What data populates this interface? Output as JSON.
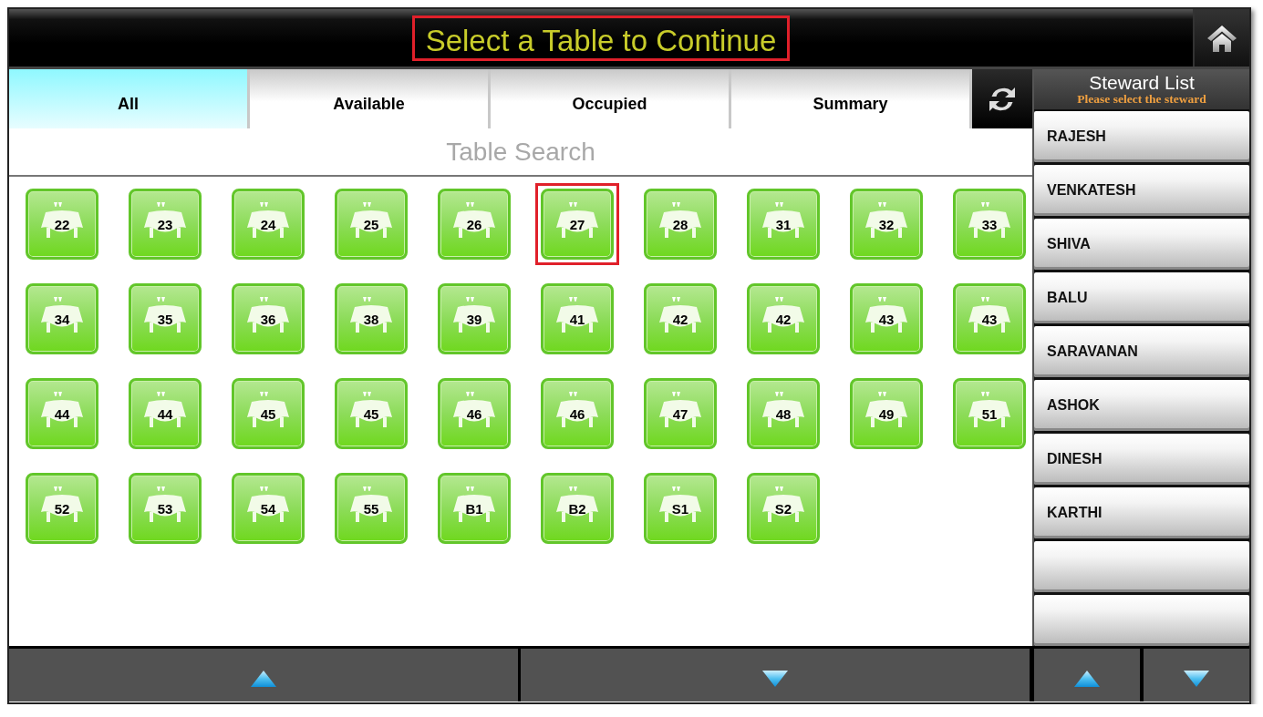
{
  "header": {
    "title": "Select a Table to Continue",
    "highlighted": true
  },
  "tabs": [
    {
      "label": "All",
      "selected": true
    },
    {
      "label": "Available",
      "selected": false
    },
    {
      "label": "Occupied",
      "selected": false
    },
    {
      "label": "Summary",
      "selected": false
    }
  ],
  "search": {
    "placeholder": "Table Search"
  },
  "tables": [
    {
      "number": "22",
      "highlighted": false
    },
    {
      "number": "23",
      "highlighted": false
    },
    {
      "number": "24",
      "highlighted": false
    },
    {
      "number": "25",
      "highlighted": false
    },
    {
      "number": "26",
      "highlighted": false
    },
    {
      "number": "27",
      "highlighted": true
    },
    {
      "number": "28",
      "highlighted": false
    },
    {
      "number": "31",
      "highlighted": false
    },
    {
      "number": "32",
      "highlighted": false
    },
    {
      "number": "33",
      "highlighted": false
    },
    {
      "number": "34",
      "highlighted": false
    },
    {
      "number": "35",
      "highlighted": false
    },
    {
      "number": "36",
      "highlighted": false
    },
    {
      "number": "38",
      "highlighted": false
    },
    {
      "number": "39",
      "highlighted": false
    },
    {
      "number": "41",
      "highlighted": false
    },
    {
      "number": "42",
      "highlighted": false
    },
    {
      "number": "42",
      "highlighted": false
    },
    {
      "number": "43",
      "highlighted": false
    },
    {
      "number": "43",
      "highlighted": false
    },
    {
      "number": "44",
      "highlighted": false
    },
    {
      "number": "44",
      "highlighted": false
    },
    {
      "number": "45",
      "highlighted": false
    },
    {
      "number": "45",
      "highlighted": false
    },
    {
      "number": "46",
      "highlighted": false
    },
    {
      "number": "46",
      "highlighted": false
    },
    {
      "number": "47",
      "highlighted": false
    },
    {
      "number": "48",
      "highlighted": false
    },
    {
      "number": "49",
      "highlighted": false
    },
    {
      "number": "51",
      "highlighted": false
    },
    {
      "number": "52",
      "highlighted": false
    },
    {
      "number": "53",
      "highlighted": false
    },
    {
      "number": "54",
      "highlighted": false
    },
    {
      "number": "55",
      "highlighted": false
    },
    {
      "number": "B1",
      "highlighted": false
    },
    {
      "number": "B2",
      "highlighted": false
    },
    {
      "number": "S1",
      "highlighted": false
    },
    {
      "number": "S2",
      "highlighted": false
    }
  ],
  "steward_panel": {
    "title": "Steward List",
    "subtitle": "Please select the steward",
    "stewards": [
      {
        "kind": "name",
        "name": "RAJESH"
      },
      {
        "kind": "name",
        "name": "VENKATESH"
      },
      {
        "kind": "name",
        "name": "SHIVA"
      },
      {
        "kind": "name",
        "name": "BALU"
      },
      {
        "kind": "name",
        "name": "SARAVANAN"
      },
      {
        "kind": "name",
        "name": "ASHOK"
      },
      {
        "kind": "name",
        "name": "DINESH"
      },
      {
        "kind": "name",
        "name": "KARTHI"
      },
      {
        "kind": "blank"
      },
      {
        "kind": "blank"
      }
    ]
  }
}
